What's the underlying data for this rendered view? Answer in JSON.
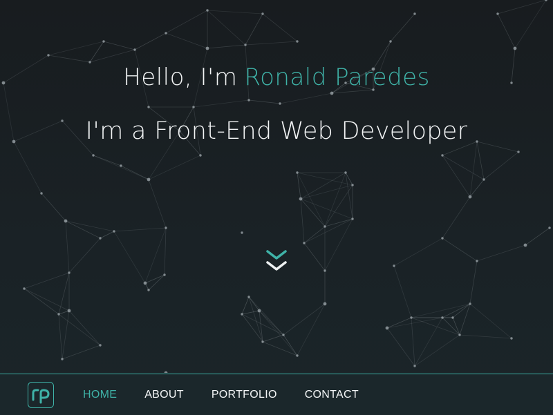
{
  "hero": {
    "greeting": "Hello, I'm",
    "name": "Ronald Paredes",
    "tagline": "I'm a Front-End Web Developer"
  },
  "scroll_icon": "double-chevron-down-icon",
  "logo": {
    "icon": "rp-logo-icon",
    "text": "rp"
  },
  "nav": {
    "items": [
      {
        "label": "HOME",
        "active": true
      },
      {
        "label": "ABOUT",
        "active": false
      },
      {
        "label": "PORTFOLIO",
        "active": false
      },
      {
        "label": "CONTACT",
        "active": false
      }
    ]
  },
  "colors": {
    "accent": "#3fb3a8",
    "background": "#181d20",
    "text": "#f2f4f5",
    "network_lines": "#6b7478"
  }
}
